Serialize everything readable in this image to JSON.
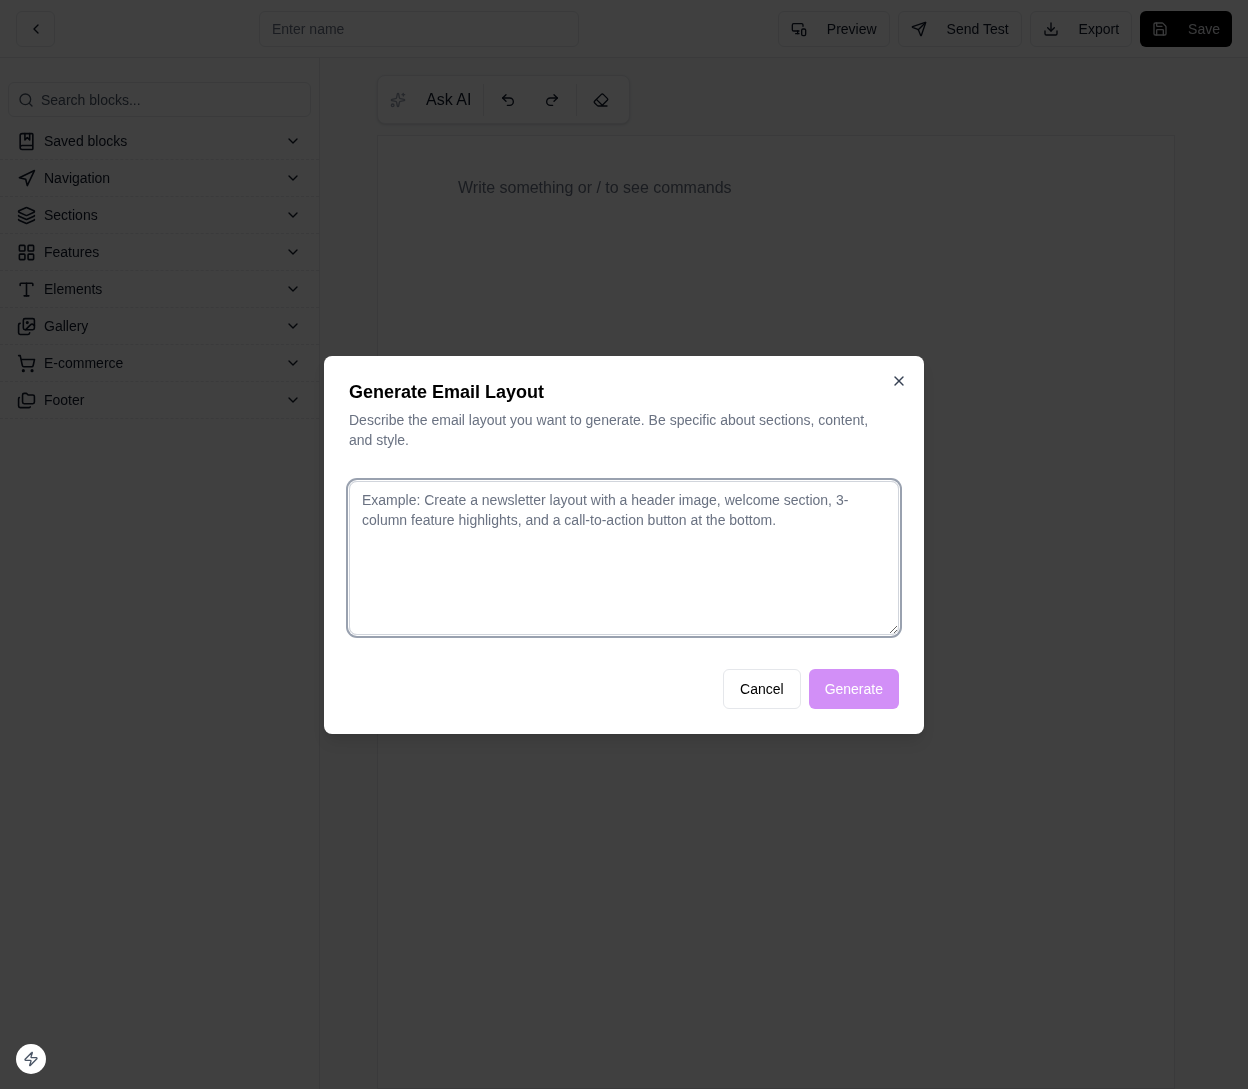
{
  "topbar": {
    "name_field": {
      "placeholder": "Enter name"
    },
    "actions": [
      {
        "label": "Preview",
        "kind": "outline"
      },
      {
        "label": "Send Test",
        "kind": "outline"
      },
      {
        "label": "Export",
        "kind": "outline"
      },
      {
        "label": "Save",
        "kind": "primary"
      }
    ]
  },
  "sidebar": {
    "search": {
      "placeholder": "Search blocks..."
    },
    "categories": [
      {
        "label": "Saved blocks",
        "expanded": false
      },
      {
        "label": "Navigation",
        "expanded": false
      },
      {
        "label": "Sections",
        "expanded": false
      },
      {
        "label": "Features",
        "expanded": false
      },
      {
        "label": "Elements",
        "expanded": false
      },
      {
        "label": "Gallery",
        "expanded": false
      },
      {
        "label": "E-commerce",
        "expanded": false
      },
      {
        "label": "Footer",
        "expanded": false
      }
    ]
  },
  "toolbar": {
    "ask_ai": "Ask AI"
  },
  "editor": {
    "placeholder": "Write something or / to see commands"
  },
  "dialog": {
    "title": "Generate Email Layout",
    "description": "Describe the email layout you want to generate. Be specific about sections, content, and style.",
    "prompt_field": {
      "placeholder": "Example: Create a newsletter layout with a header image, welcome section, 3-column feature highlights, and a call-to-action button at the bottom."
    },
    "buttons": [
      {
        "label": "Cancel",
        "kind": "secondary",
        "disabled": false
      },
      {
        "label": "Generate",
        "kind": "primary",
        "disabled": true
      }
    ]
  }
}
